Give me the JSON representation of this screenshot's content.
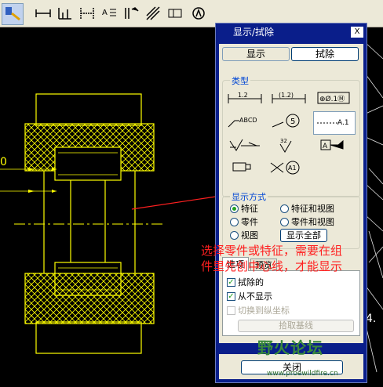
{
  "dialog": {
    "title": "显示/拭除",
    "close_glyph": "X",
    "show_button": "显示",
    "erase_button": "拭除",
    "type_group_label": "类型",
    "type_icons": [
      "dimension-icon",
      "reference-dimension-icon",
      "geometric-tolerance-icon",
      "note-icon",
      "balloon-icon",
      "datum-target-icon",
      "surface-finish-icon",
      "symbol-icon",
      "datum-plane-tag-icon",
      "cosmetic-feature-icon",
      "axis-datum-icon"
    ],
    "type_icon_texts": {
      "dim1": "1.2",
      "dim2": "(1.2)",
      "gtol": "⊕Ø.1Ⓜ",
      "note": "ABCD",
      "balloon": "5",
      "datum_target": "A.1",
      "finish": "32",
      "datum_tag": "A",
      "axis": "A1"
    },
    "display_mode_label": "显示方式",
    "radios": [
      {
        "label": "特征",
        "checked": true
      },
      {
        "label": "特征和视图",
        "checked": false
      },
      {
        "label": "零件",
        "checked": false
      },
      {
        "label": "零件和视图",
        "checked": false
      },
      {
        "label": "视图",
        "checked": false
      }
    ],
    "show_all_button": "显示全部",
    "tabs": [
      "选项",
      "预览"
    ],
    "options": [
      {
        "label": "拭除的",
        "checked": true,
        "disabled": false
      },
      {
        "label": "从不显示",
        "checked": true,
        "disabled": false
      },
      {
        "label": "切换到纵坐标",
        "checked": false,
        "disabled": true
      }
    ],
    "pick_baseline_button": "拾取基线",
    "bottom_close_button": "关闭"
  },
  "annotation_text": "选择零件或特征，需要在组件里先创中心线，才能显示",
  "watermark": {
    "logo": "野火论坛",
    "url": "www.proewildfire.cn"
  },
  "canvas_texts": {
    "left_mark": "0",
    "right_mark": "4."
  },
  "colors": {
    "canvas_bg": "#000000",
    "cad_yellow": "#ffff00",
    "dialog_frame": "#0a1e8a",
    "annotation_red": "#ff2020",
    "dialog_face": "#ece9d8"
  }
}
